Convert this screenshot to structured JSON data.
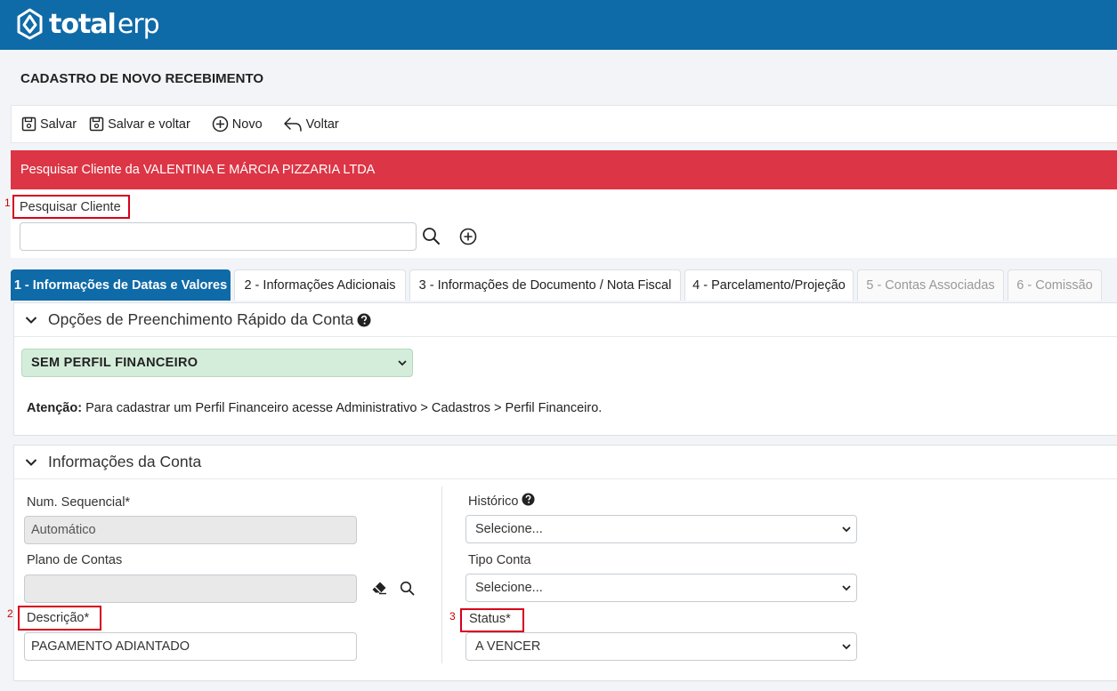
{
  "app": {
    "brand_bold": "total",
    "brand_light": "erp"
  },
  "page": {
    "title": "CADASTRO DE NOVO RECEBIMENTO"
  },
  "toolbar": {
    "save_label": "Salvar",
    "save_back_label": "Salvar e voltar",
    "new_label": "Novo",
    "back_label": "Voltar"
  },
  "alert": {
    "text": "Pesquisar Cliente da VALENTINA E MÁRCIA PIZZARIA LTDA"
  },
  "client_search": {
    "label": "Pesquisar Cliente",
    "value": "",
    "marker": "1"
  },
  "tabs": [
    {
      "label": "1 - Informações de Datas e Valores",
      "state": "active"
    },
    {
      "label": "2 - Informações Adicionais",
      "state": "normal"
    },
    {
      "label": "3 - Informações de Documento / Nota Fiscal",
      "state": "normal"
    },
    {
      "label": "4 - Parcelamento/Projeção",
      "state": "normal"
    },
    {
      "label": "5 - Contas Associadas",
      "state": "disabled"
    },
    {
      "label": "6 - Comissão",
      "state": "disabled"
    }
  ],
  "quick_fill": {
    "title": "Opções de Preenchimento Rápido da Conta",
    "profile_select": "SEM PERFIL FINANCEIRO",
    "notice_strong": "Atenção:",
    "notice_text": " Para cadastrar um Perfil Financeiro acesse Administrativo > Cadastros > Perfil Financeiro."
  },
  "account_info": {
    "title": "Informações da Conta",
    "seq_label": "Num. Sequencial*",
    "seq_value": "Automático",
    "plan_label": "Plano de Contas",
    "plan_value": "",
    "desc_label": "Descrição*",
    "desc_value": "PAGAMENTO ADIANTADO",
    "desc_marker": "2",
    "history_label": "Histórico",
    "history_value": "Selecione...",
    "type_label": "Tipo Conta",
    "type_value": "Selecione...",
    "status_label": "Status*",
    "status_value": "A VENCER",
    "status_marker": "3"
  },
  "colors": {
    "brand": "#0f6aa8",
    "alert": "#dc3545",
    "highlight": "#d6001c",
    "profile_bg": "#d4edda"
  },
  "icons": [
    "home-logo-icon",
    "save-icon",
    "plus-circle-icon",
    "undo-icon",
    "search-icon",
    "chevron-down-icon",
    "question-circle-icon",
    "eraser-icon"
  ]
}
